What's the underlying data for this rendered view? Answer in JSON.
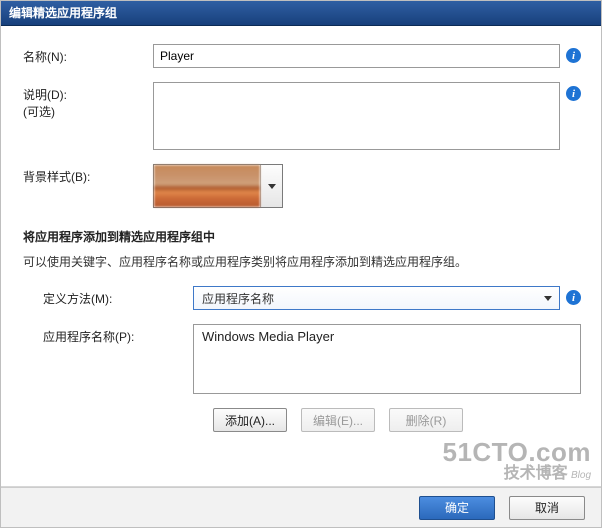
{
  "title": "编辑精选应用程序组",
  "labels": {
    "name": "名称(N):",
    "desc": "说明(D):",
    "optional": "(可选)",
    "bgstyle": "背景样式(B):",
    "method": "定义方法(M):",
    "appname": "应用程序名称(P):"
  },
  "values": {
    "name": "Player",
    "method_selected": "应用程序名称",
    "app_list_item": "Windows Media Player"
  },
  "section": {
    "heading": "将应用程序添加到精选应用程序组中",
    "help": "可以使用关键字、应用程序名称或应用程序类别将应用程序添加到精选应用程序组。"
  },
  "buttons": {
    "add": "添加(A)...",
    "edit": "编辑(E)...",
    "delete": "删除(R)",
    "ok": "确定",
    "cancel": "取消"
  },
  "info_glyph": "i",
  "watermark": {
    "line1": "51CTO.com",
    "line2": "技术博客",
    "blog": "Blog"
  }
}
